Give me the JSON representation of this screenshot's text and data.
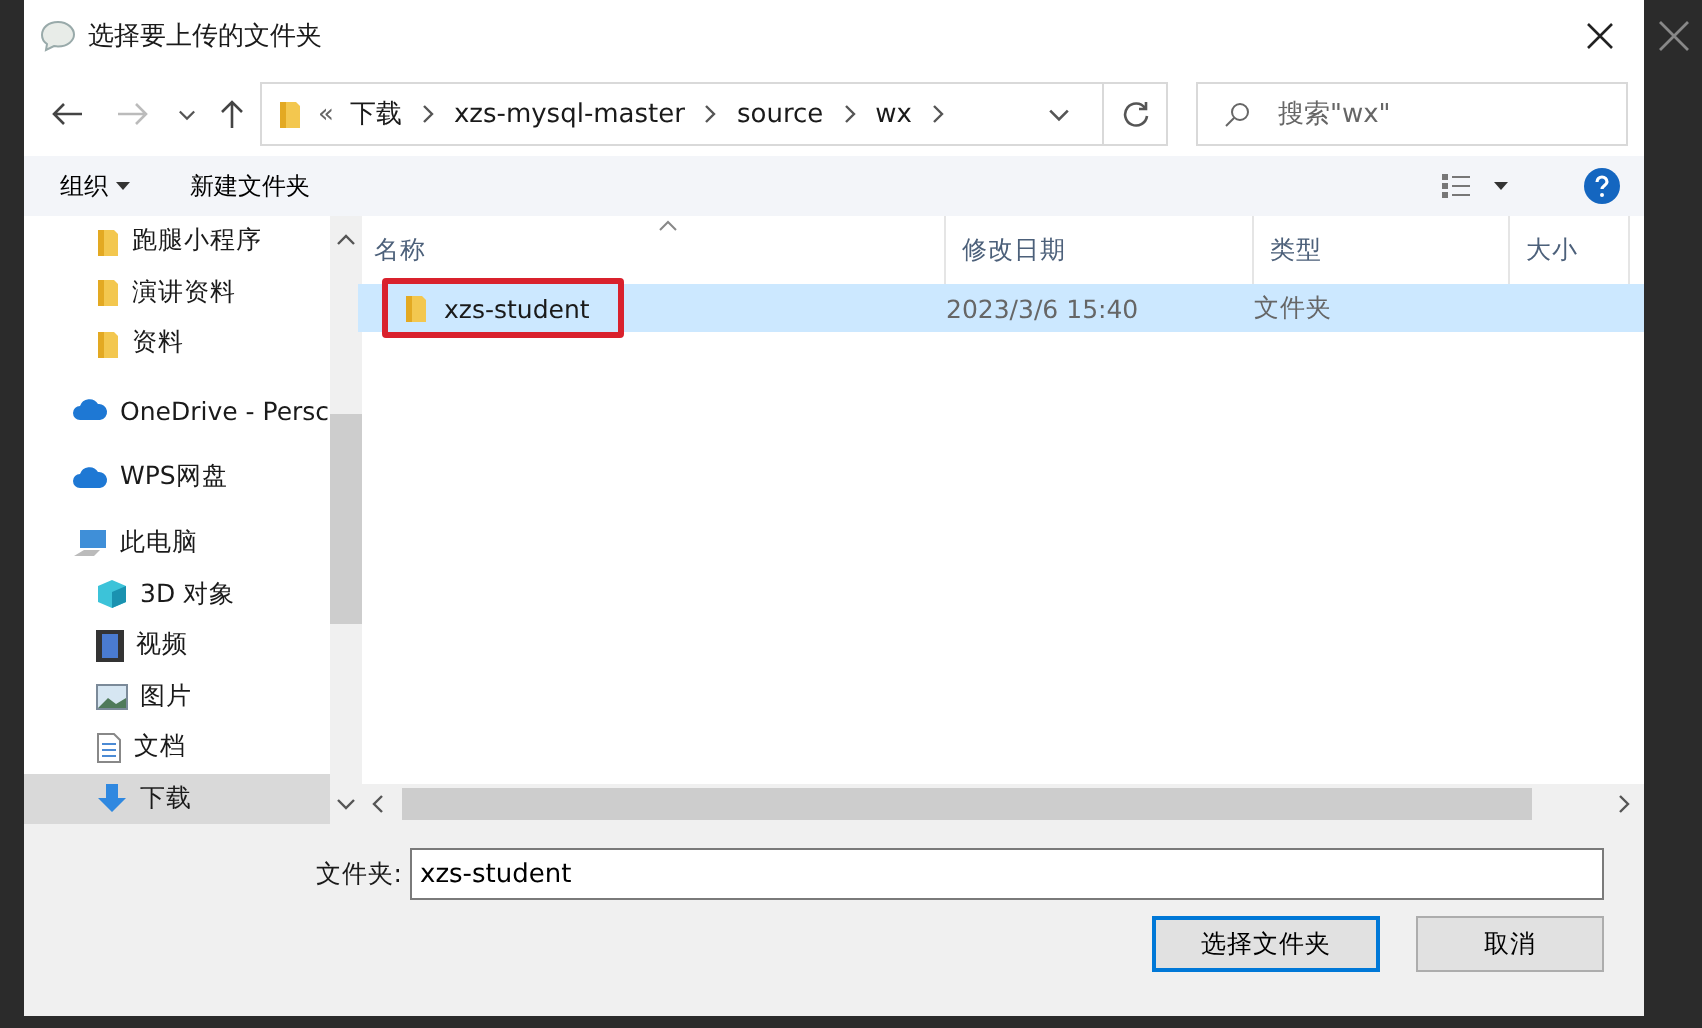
{
  "window": {
    "title": "选择要上传的文件夹"
  },
  "address": {
    "crumbs": [
      "«",
      "下载",
      "xzs-mysql-master",
      "source",
      "wx"
    ]
  },
  "search": {
    "placeholder": "搜索\"wx\""
  },
  "toolbar": {
    "organize": "组织",
    "new_folder": "新建文件夹"
  },
  "sidebar": {
    "items": [
      {
        "label": "跑腿小程序",
        "kind": "folder",
        "selected": false
      },
      {
        "label": "演讲资料",
        "kind": "folder",
        "selected": false
      },
      {
        "label": "资料",
        "kind": "folder",
        "selected": false
      },
      {
        "label": "OneDrive - Persc",
        "kind": "cloud",
        "selected": false
      },
      {
        "label": "WPS网盘",
        "kind": "cloud",
        "selected": false
      },
      {
        "label": "此电脑",
        "kind": "pc",
        "selected": false
      },
      {
        "label": "3D 对象",
        "kind": "cube",
        "selected": false
      },
      {
        "label": "视频",
        "kind": "video",
        "selected": false
      },
      {
        "label": "图片",
        "kind": "image",
        "selected": false
      },
      {
        "label": "文档",
        "kind": "doc",
        "selected": false
      },
      {
        "label": "下载",
        "kind": "download",
        "selected": true
      }
    ]
  },
  "table": {
    "columns": [
      "名称",
      "修改日期",
      "类型",
      "大小"
    ],
    "rows": [
      {
        "name": "xzs-student",
        "date": "2023/3/6 15:40",
        "type": "文件夹",
        "selected": true,
        "highlighted": true
      }
    ]
  },
  "footer": {
    "label": "文件夹:",
    "value": "xzs-student",
    "buttons": [
      {
        "label": "选择文件夹",
        "primary": true
      },
      {
        "label": "取消",
        "primary": false
      }
    ]
  }
}
